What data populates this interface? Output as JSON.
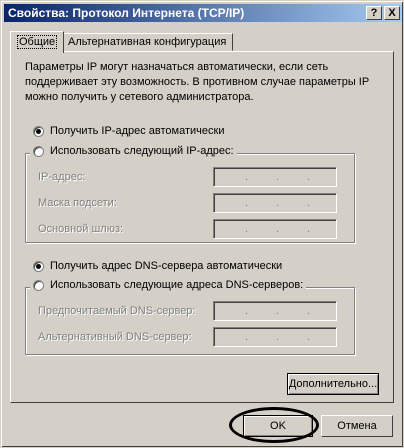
{
  "window": {
    "title": "Свойства: Протокол Интернета (TCP/IP)",
    "help_button": "?",
    "close_button": "X"
  },
  "tabs": [
    {
      "label": "Общие",
      "active": true
    },
    {
      "label": "Альтернативная конфигурация",
      "active": false
    }
  ],
  "general": {
    "description": "Параметры IP могут назначаться автоматически, если сеть поддерживает эту возможность. В противном случае параметры IP можно получить у сетевого администратора.",
    "ip_auto_label": "Получить IP-адрес автоматически",
    "ip_auto_selected": true,
    "ip_manual_label": "Использовать следующий IP-адрес:",
    "ip_address_label": "IP-адрес:",
    "subnet_mask_label": "Маска подсети:",
    "default_gateway_label": "Основной шлюз:",
    "dns_auto_label": "Получить адрес DNS-сервера автоматически",
    "dns_auto_selected": true,
    "dns_manual_label": "Использовать следующие адреса DNS-серверов:",
    "preferred_dns_label": "Предпочитаемый DNS-сервер:",
    "alternate_dns_label": "Альтернативный DNS-сервер:",
    "ip_dot": "."
  },
  "buttons": {
    "advanced": "Дополнительно...",
    "ok": "OK",
    "cancel": "Отмена"
  }
}
